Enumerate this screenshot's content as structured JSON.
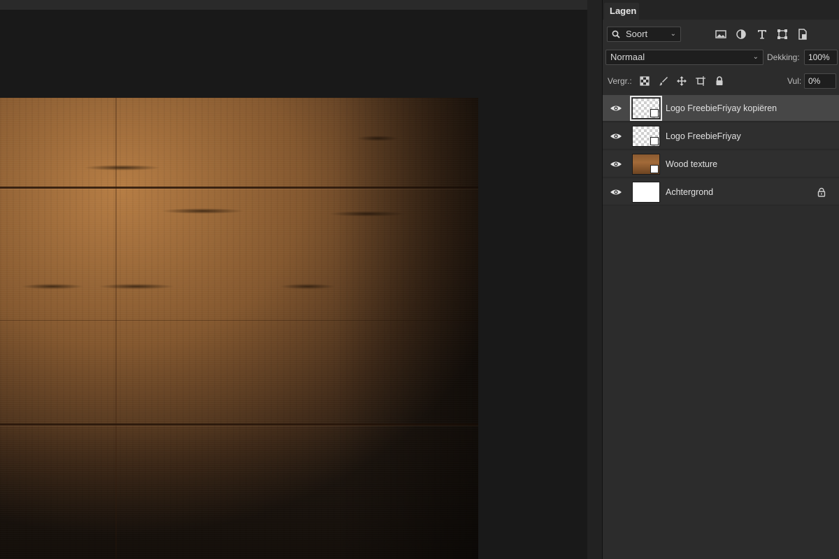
{
  "panel": {
    "tab_label": "Lagen",
    "kind_filter": {
      "value": "Soort"
    },
    "filter_icons": [
      "image-filter-icon",
      "adjustment-filter-icon",
      "type-filter-icon",
      "shape-filter-icon",
      "smart-object-filter-icon"
    ],
    "blend_mode": {
      "value": "Normaal"
    },
    "opacity": {
      "label": "Dekking:",
      "value": "100%"
    },
    "lock": {
      "label": "Vergr.:"
    },
    "fill": {
      "label": "Vul:",
      "value": "0%"
    }
  },
  "layers": [
    {
      "name": "Logo FreebieFriyay kopiëren",
      "visible": true,
      "selected": true,
      "thumbnail": "transparent",
      "smart_object": true
    },
    {
      "name": "Logo FreebieFriyay",
      "visible": true,
      "selected": false,
      "thumbnail": "transparent",
      "smart_object": true
    },
    {
      "name": "Wood texture",
      "visible": true,
      "selected": false,
      "thumbnail": "wood",
      "smart_object": true
    },
    {
      "name": "Achtergrond",
      "visible": true,
      "selected": false,
      "thumbnail": "white",
      "locked": true
    }
  ],
  "colors": {
    "panel_bg": "#2c2c2c",
    "selected_row": "#474747",
    "canvas_bg": "#191919"
  }
}
